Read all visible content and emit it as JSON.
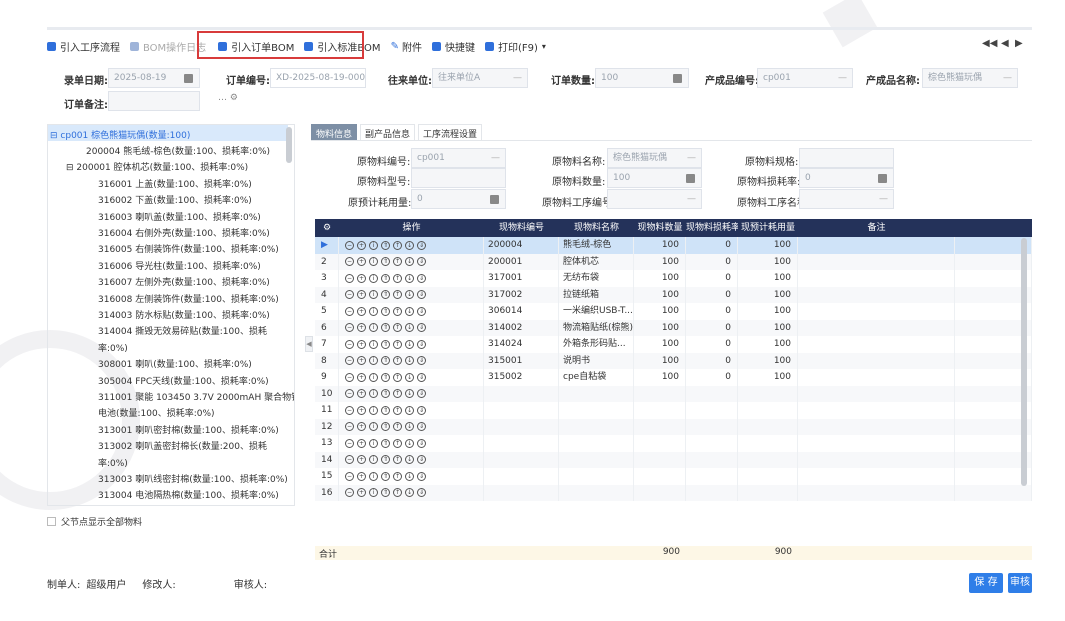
{
  "toolbar": {
    "items": [
      {
        "label": "引入工序流程",
        "icon": "import-doc-icon",
        "disabled": false
      },
      {
        "label": "BOM操作日志",
        "icon": "log-icon",
        "disabled": true
      },
      {
        "label": "引入订单BOM",
        "icon": "import-doc-icon",
        "disabled": false
      },
      {
        "label": "引入标准BOM",
        "icon": "import-doc-icon",
        "disabled": false
      },
      {
        "label": "附件",
        "icon": "paperclip-icon",
        "disabled": false
      },
      {
        "label": "快捷键",
        "icon": "keyboard-icon",
        "disabled": false
      },
      {
        "label": "打印(F9)",
        "icon": "printer-icon",
        "disabled": false
      }
    ],
    "print_caret": "▾",
    "nav": {
      "first": "◀◀",
      "prev": "◀",
      "next": "▶"
    }
  },
  "form": {
    "record_date_label": "录单日期:",
    "record_date": "2025-08-19",
    "order_no_label": "订单编号:",
    "order_no": "XD-2025-08-19-0001",
    "partner_label": "往来单位:",
    "partner": "往来单位A",
    "order_qty_label": "订单数量:",
    "order_qty": "100",
    "product_code_label": "产成品编号:",
    "product_code": "cp001",
    "product_name_label": "产成品名称:",
    "product_name": "棕色熊猫玩偶",
    "remark_label": "订单备注:",
    "remark": "",
    "remark_icons": "…  ⚙"
  },
  "tree": {
    "root": "⊟ cp001 棕色熊猫玩偶(数量:100)",
    "lines": [
      "200004 熊毛绒-棕色(数量:100、损耗率:0%)",
      "⊟    200001 腔体机芯(数量:100、损耗率:0%)",
      "316001 上盖(数量:100、损耗率:0%)",
      "316002 下盖(数量:100、损耗率:0%)",
      "316003 喇叭盖(数量:100、损耗率:0%)",
      "316004 右侧外壳(数量:100、损耗率:0%)",
      "316005 右侧装饰件(数量:100、损耗率:0%)",
      "316006 导光柱(数量:100、损耗率:0%)",
      "316007 左侧外壳(数量:100、损耗率:0%)",
      "316008 左侧装饰件(数量:100、损耗率:0%)",
      "314003 防水标贴(数量:100、损耗率:0%)",
      "314004 撕毁无效易碎贴(数量:100、损耗",
      "率:0%)",
      "308001 喇叭(数量:100、损耗率:0%)",
      "305004 FPC天线(数量:100、损耗率:0%)",
      "311001 聚能 103450 3.7V 2000mAH 聚合物锂",
      "电池(数量:100、损耗率:0%)",
      "313001 喇叭密封棉(数量:100、损耗率:0%)",
      "313002 喇叭盖密封棉长(数量:200、损耗",
      "率:0%)",
      "313003 喇叭线密封棉(数量:100、损耗率:0%)",
      "313004 电池隔热棉(数量:100、损耗率:0%)"
    ],
    "show_all_label": "父节点显示全部物料"
  },
  "tabs": [
    "物料信息",
    "副产品信息",
    "工序流程设置"
  ],
  "material": {
    "code_label": "原物料编号:",
    "code": "cp001",
    "name_label": "原物料名称:",
    "name": "棕色熊猫玩偶",
    "spec_label": "原物料规格:",
    "spec": "",
    "model_label": "原物料型号:",
    "model": "",
    "qty_label": "原物料数量:",
    "qty": "100",
    "loss_label": "原物料损耗率:",
    "loss": "0",
    "plan_label": "原预计耗用量:",
    "plan": "0",
    "proc_code_label": "原物料工序编号",
    "proc_code": "",
    "proc_name_label": "原物料工序名称",
    "proc_name": ""
  },
  "grid": {
    "headers": [
      "",
      "操作",
      "现物料编号",
      "现物料名称",
      "现物料数量",
      "现物料损耗率",
      "现预计耗用量",
      "备注"
    ],
    "op_icons": [
      "−",
      "+",
      "i",
      "⇑",
      "↑",
      "↓",
      "⇓"
    ],
    "rows": [
      {
        "no": "▶",
        "code": "200004",
        "name": "熊毛绒-棕色",
        "qty": "100",
        "loss": "0",
        "plan": "100"
      },
      {
        "no": "2",
        "code": "200001",
        "name": "腔体机芯",
        "qty": "100",
        "loss": "0",
        "plan": "100"
      },
      {
        "no": "3",
        "code": "317001",
        "name": "无纺布袋",
        "qty": "100",
        "loss": "0",
        "plan": "100"
      },
      {
        "no": "4",
        "code": "317002",
        "name": "拉链纸箱",
        "qty": "100",
        "loss": "0",
        "plan": "100"
      },
      {
        "no": "5",
        "code": "306014",
        "name": "一米编织USB-T...",
        "qty": "100",
        "loss": "0",
        "plan": "100"
      },
      {
        "no": "6",
        "code": "314002",
        "name": "物流箱贴纸(棕熊)",
        "qty": "100",
        "loss": "0",
        "plan": "100"
      },
      {
        "no": "7",
        "code": "314024",
        "name": "外箱条形码贴...",
        "qty": "100",
        "loss": "0",
        "plan": "100"
      },
      {
        "no": "8",
        "code": "315001",
        "name": "说明书",
        "qty": "100",
        "loss": "0",
        "plan": "100"
      },
      {
        "no": "9",
        "code": "315002",
        "name": "cpe自粘袋",
        "qty": "100",
        "loss": "0",
        "plan": "100"
      },
      {
        "no": "10",
        "code": "",
        "name": "",
        "qty": "",
        "loss": "",
        "plan": ""
      },
      {
        "no": "11",
        "code": "",
        "name": "",
        "qty": "",
        "loss": "",
        "plan": ""
      },
      {
        "no": "12",
        "code": "",
        "name": "",
        "qty": "",
        "loss": "",
        "plan": ""
      },
      {
        "no": "13",
        "code": "",
        "name": "",
        "qty": "",
        "loss": "",
        "plan": ""
      },
      {
        "no": "14",
        "code": "",
        "name": "",
        "qty": "",
        "loss": "",
        "plan": ""
      },
      {
        "no": "15",
        "code": "",
        "name": "",
        "qty": "",
        "loss": "",
        "plan": ""
      },
      {
        "no": "16",
        "code": "",
        "name": "",
        "qty": "",
        "loss": "",
        "plan": ""
      }
    ],
    "total_label": "合计",
    "total_qty": "900",
    "total_plan": "900"
  },
  "footer": {
    "creator_label": "制单人:",
    "creator": "超级用户",
    "modifier_label": "修改人:",
    "modifier": "",
    "auditor_label": "审核人:",
    "auditor": ""
  },
  "buttons": {
    "save": "保 存",
    "audit": "审核"
  },
  "colors": {
    "accent": "#2f7ee8",
    "header": "#24325a",
    "highlight": "#d83b3b",
    "selected": "#cfe3f8"
  }
}
